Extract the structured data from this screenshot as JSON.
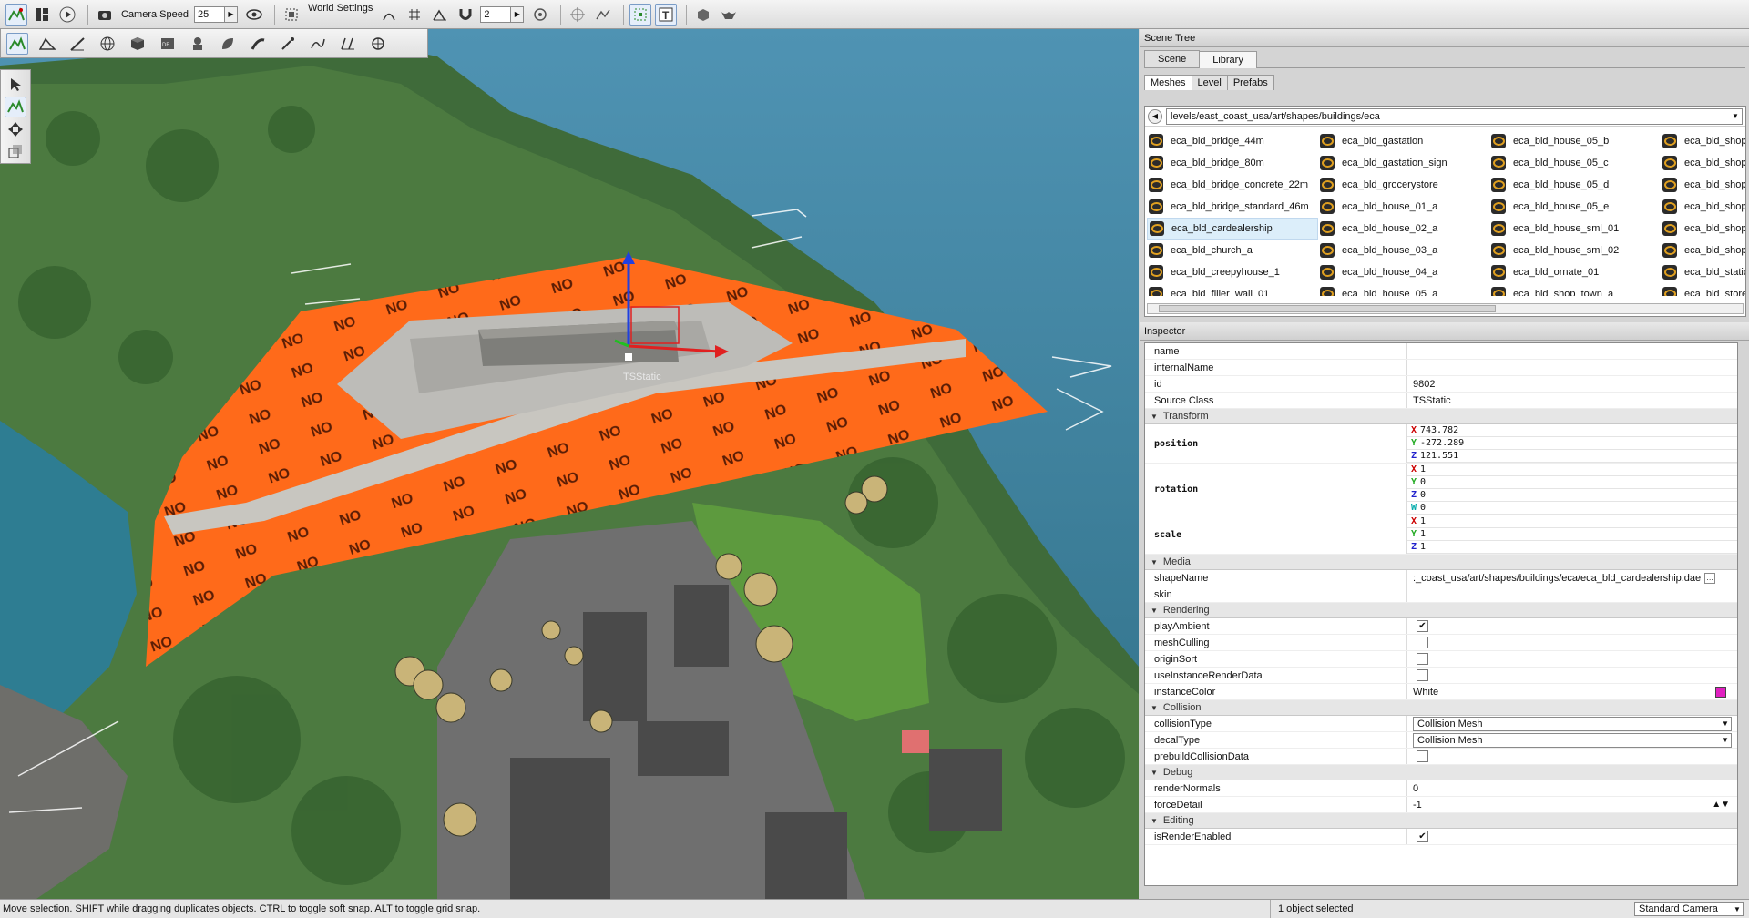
{
  "toolbar": {
    "camera_speed_label": "Camera Speed",
    "camera_speed_value": "25",
    "world_settings_label": "World Settings",
    "grid_value": "2"
  },
  "viewport": {
    "selected_object_label": "TSStatic",
    "decal_text": "NO"
  },
  "scene_tree": {
    "title": "Scene Tree",
    "tabs": [
      {
        "label": "Scene",
        "selected": false
      },
      {
        "label": "Library",
        "selected": true
      }
    ],
    "subtabs": [
      {
        "label": "Meshes",
        "selected": true
      },
      {
        "label": "Level",
        "selected": false
      },
      {
        "label": "Prefabs",
        "selected": false
      }
    ],
    "path": "levels/east_coast_usa/art/shapes/buildings/eca",
    "meshes": [
      [
        "eca_bld_bridge_44m",
        "eca_bld_gastation",
        "eca_bld_house_05_b",
        "eca_bld_shop_"
      ],
      [
        "eca_bld_bridge_80m",
        "eca_bld_gastation_sign",
        "eca_bld_house_05_c",
        "eca_bld_shop_"
      ],
      [
        "eca_bld_bridge_concrete_22m",
        "eca_bld_grocerystore",
        "eca_bld_house_05_d",
        "eca_bld_shop_"
      ],
      [
        "eca_bld_bridge_standard_46m",
        "eca_bld_house_01_a",
        "eca_bld_house_05_e",
        "eca_bld_shop_"
      ],
      [
        "eca_bld_cardealership",
        "eca_bld_house_02_a",
        "eca_bld_house_sml_01",
        "eca_bld_shop_"
      ],
      [
        "eca_bld_church_a",
        "eca_bld_house_03_a",
        "eca_bld_house_sml_02",
        "eca_bld_shop_"
      ],
      [
        "eca_bld_creepyhouse_1",
        "eca_bld_house_04_a",
        "eca_bld_ornate_01",
        "eca_bld_statio"
      ],
      [
        "eca_bld_filler_wall_01",
        "eca_bld_house_05_a",
        "eca_bld_shop_town_a",
        "eca_bld_store_"
      ]
    ],
    "selected_mesh": "eca_bld_cardealership"
  },
  "inspector": {
    "title": "Inspector",
    "basic": [
      {
        "key": "name",
        "value": ""
      },
      {
        "key": "internalName",
        "value": ""
      },
      {
        "key": "id",
        "value": "9802"
      },
      {
        "key": "Source Class",
        "value": "TSStatic"
      }
    ],
    "sections": {
      "transform": "Transform",
      "media": "Media",
      "rendering": "Rendering",
      "collision": "Collision",
      "debug": "Debug",
      "editing": "Editing"
    },
    "position": {
      "label": "position",
      "x": "743.782",
      "y": "-272.289",
      "z": "121.551"
    },
    "rotation": {
      "label": "rotation",
      "x": "1",
      "y": "0",
      "z": "0",
      "w": "0"
    },
    "scale": {
      "label": "scale",
      "x": "1",
      "y": "1",
      "z": "1"
    },
    "axes": {
      "x": "X",
      "y": "Y",
      "z": "Z",
      "w": "W"
    },
    "media": [
      {
        "key": "shapeName",
        "value": ":_coast_usa/art/shapes/buildings/eca/eca_bld_cardealership.dae"
      },
      {
        "key": "skin",
        "value": ""
      }
    ],
    "rendering": [
      {
        "key": "playAmbient",
        "checked": true
      },
      {
        "key": "meshCulling",
        "checked": false
      },
      {
        "key": "originSort",
        "checked": false
      },
      {
        "key": "useInstanceRenderData",
        "checked": false
      }
    ],
    "instance_color": {
      "key": "instanceColor",
      "value": "White",
      "swatch": "#e020c0"
    },
    "collision": [
      {
        "key": "collisionType",
        "value": "Collision Mesh"
      },
      {
        "key": "decalType",
        "value": "Collision Mesh"
      }
    ],
    "prebuild": {
      "key": "prebuildCollisionData",
      "checked": false
    },
    "debug": [
      {
        "key": "renderNormals",
        "value": "0"
      },
      {
        "key": "forceDetail",
        "value": "-1"
      }
    ],
    "editing": [
      {
        "key": "isRenderEnabled",
        "checked": true
      }
    ]
  },
  "status": {
    "message": "Move selection.  SHIFT while dragging duplicates objects.  CTRL to toggle soft snap.  ALT to toggle grid snap.",
    "selection": "1 object selected",
    "camera": "Standard Camera"
  },
  "colors": {
    "decal_orange": "#ff6a1a",
    "axis_x": "#e02020",
    "axis_y": "#20c020",
    "axis_z": "#2040e0",
    "water": "#2e7d92"
  }
}
